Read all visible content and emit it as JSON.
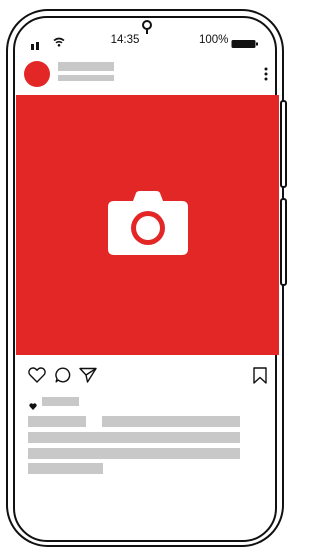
{
  "status_bar": {
    "time": "14:35",
    "battery_percent": "100%",
    "signal_icon": "signal-bars-icon",
    "wifi_icon": "wifi-icon",
    "battery_icon": "battery-icon"
  },
  "post": {
    "more_icon": "more-vertical-icon",
    "photo_icon": "camera-icon",
    "actions": [
      "heart-icon",
      "comment-icon",
      "share-icon",
      "bookmark-icon"
    ],
    "likes_icon": "small-heart-icon"
  },
  "colors": {
    "accent": "#e32626",
    "placeholder": "#c8c8c8",
    "stroke": "#111111"
  }
}
